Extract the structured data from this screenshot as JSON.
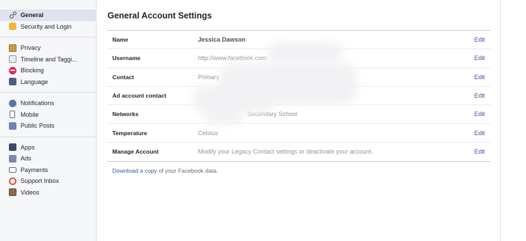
{
  "sidebar": {
    "groups": [
      [
        {
          "label": "General",
          "icon": "gear-icon",
          "active": true
        },
        {
          "label": "Security and Login",
          "icon": "shield-icon"
        }
      ],
      [
        {
          "label": "Privacy",
          "icon": "lock-icon"
        },
        {
          "label": "Timeline and Taggi...",
          "icon": "timeline-icon"
        },
        {
          "label": "Blocking",
          "icon": "block-icon"
        },
        {
          "label": "Language",
          "icon": "language-icon"
        }
      ],
      [
        {
          "label": "Notifications",
          "icon": "globe-icon"
        },
        {
          "label": "Mobile",
          "icon": "phone-icon"
        },
        {
          "label": "Public Posts",
          "icon": "rss-icon"
        }
      ],
      [
        {
          "label": "Apps",
          "icon": "apps-icon"
        },
        {
          "label": "Ads",
          "icon": "ads-icon"
        },
        {
          "label": "Payments",
          "icon": "card-icon"
        },
        {
          "label": "Support Inbox",
          "icon": "lifebuoy-icon"
        },
        {
          "label": "Videos",
          "icon": "film-icon"
        }
      ]
    ]
  },
  "main": {
    "title": "General Account Settings",
    "rows": [
      {
        "label": "Name",
        "value": "Jessica Dawson",
        "edit": "Edit"
      },
      {
        "label": "Username",
        "value": "http://www.facebook.com",
        "edit": "Edit"
      },
      {
        "label": "Contact",
        "value": "Primary",
        "edit": "Edit"
      },
      {
        "label": "Ad account contact",
        "value": "",
        "edit": "Edit"
      },
      {
        "label": "Networks",
        "value": "Secondary School",
        "edit": "Edit"
      },
      {
        "label": "Temperature",
        "value": "Celsius",
        "edit": "Edit"
      },
      {
        "label": "Manage Account",
        "value": "Modify your Legacy Contact settings or deactivate your account.",
        "edit": "Edit"
      }
    ],
    "download": {
      "link": "Download a copy",
      "rest": " of your Facebook data."
    }
  }
}
